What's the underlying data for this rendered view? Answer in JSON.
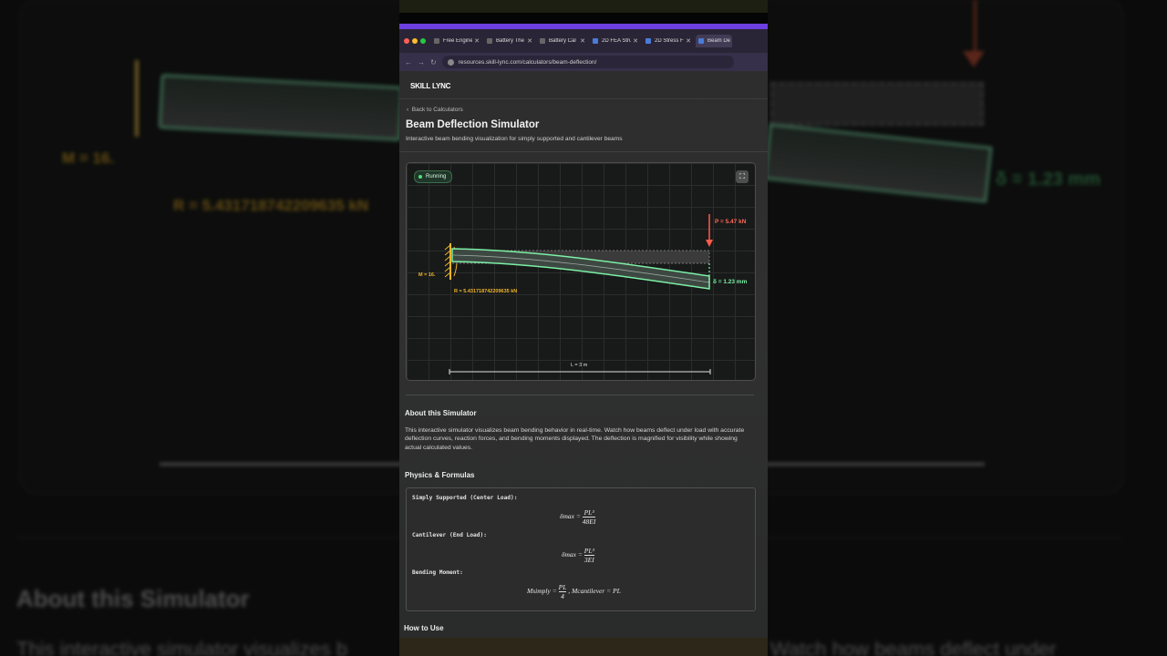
{
  "background": {
    "moment_label": "M = 16.",
    "reaction_label": "R = 5.43171874220​9635 kN",
    "deflection_label": "δ = 1.23 mm",
    "about_heading": "About this Simulator",
    "about_left": "This interactive simulator visualizes b",
    "about_right": "Watch how beams deflect under"
  },
  "browser": {
    "tabs": [
      {
        "label": "Free Engine"
      },
      {
        "label": "Battery The"
      },
      {
        "label": "Battery Cal"
      },
      {
        "label": "2D FEA Stru"
      },
      {
        "label": "2D Stress F"
      },
      {
        "label": "Beam De"
      }
    ],
    "url": "resources.skill-lync.com/calculators/beam-deflection/"
  },
  "page": {
    "logo": "SKILL LYNC",
    "back_link": "Back to Calculators",
    "title": "Beam Deflection Simulator",
    "subtitle": "Interactive beam bending visualization for simply supported and cantilever beams"
  },
  "simulator": {
    "status": "Running",
    "load_label": "P = 5.47 kN",
    "deflection_label": "δ = 1.23 mm",
    "moment_label": "M = 16.",
    "reaction_label": "R = 5.431718742209635 kN",
    "length_label": "L = 3 m"
  },
  "about": {
    "heading": "About this Simulator",
    "body": "This interactive simulator visualizes beam bending behavior in real-time. Watch how beams deflect under load with accurate deflection curves, reaction forces, and bending moments displayed. The deflection is magnified for visibility while showing actual calculated values."
  },
  "physics": {
    "heading": "Physics & Formulas",
    "items": [
      {
        "label": "Simply Supported (Center Load):",
        "lhs": "δmax =",
        "num": "PL³",
        "den": "48EI"
      },
      {
        "label": "Cantilever (End Load):",
        "lhs": "δmax =",
        "num": "PL³",
        "den": "3EI"
      },
      {
        "label": "Bending Moment:",
        "lhs": "Msimply =",
        "num": "PL",
        "den": "4",
        "extra": ",   Mcantilever = PL"
      }
    ]
  },
  "how_to": {
    "heading": "How to Use"
  },
  "colors": {
    "beam": "#7cf0a6",
    "load": "#ff5a4a",
    "support": "#f0b429",
    "accent": "#6d3fe0"
  }
}
